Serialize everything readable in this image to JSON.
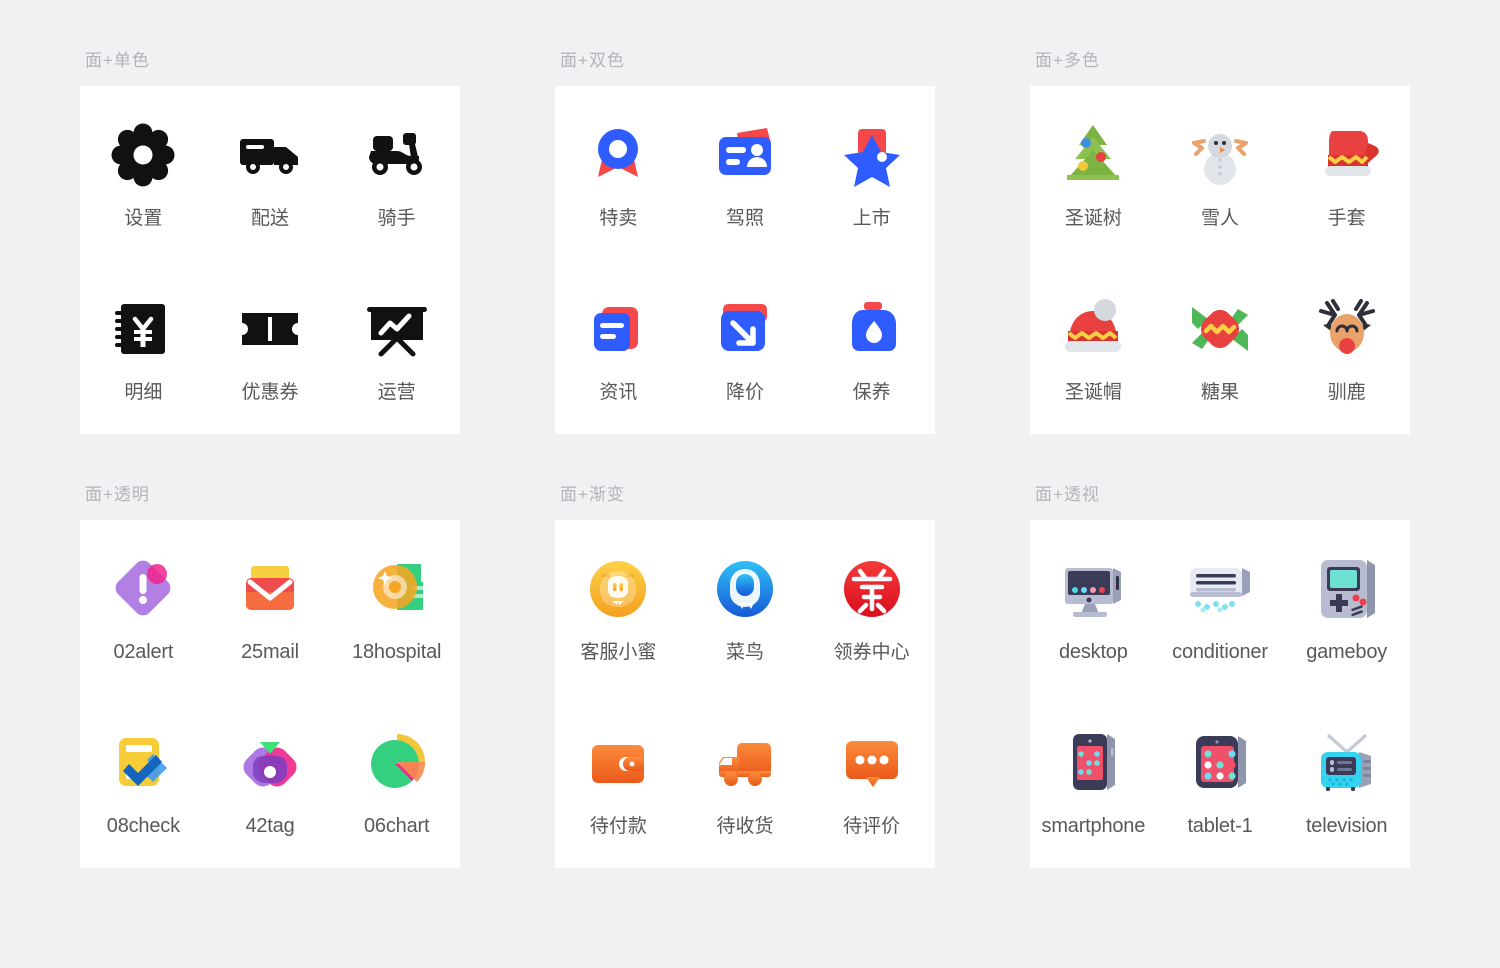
{
  "background_color": "#f0f1f3",
  "card_color": "#ffffff",
  "title_color": "#b3b5ba",
  "label_color": "#595959",
  "palette": {
    "mono_black": "#111111",
    "brand_blue": "#2f5cff",
    "brand_red": "#f5484a",
    "tree_green": "#7cb342",
    "santa_red": "#e8413f",
    "candy_yellow": "#f7d043",
    "snow_white": "#e2e6ea",
    "deer_tan": "#e8a26a",
    "purple": "#a568e0",
    "pink": "#f0258c",
    "mail_yellow": "#f7cf3f",
    "mail_red": "#ef4d4d",
    "coin_orange": "#f5a623",
    "money_green": "#35d07f",
    "check_yellow": "#f6cc38",
    "check_blue": "#1465c0",
    "gradient_orange_from": "#fb8c3c",
    "gradient_orange_to": "#ea5a1a",
    "gradient_yellow_from": "#fdd148",
    "gradient_yellow_to": "#f3a01f",
    "gradient_blue_from": "#2fc0f7",
    "gradient_blue_to": "#1559d6",
    "gradient_red_from": "#f53b3b",
    "gradient_red_to": "#d90d1e",
    "device_gray": "#b7bcd0",
    "device_navy": "#3b3b58",
    "tv_cyan": "#35d3ef"
  },
  "groups": [
    {
      "title": "面+单色",
      "style": "mono",
      "items": [
        {
          "label": "设置",
          "icon": "gear-icon"
        },
        {
          "label": "配送",
          "icon": "truck-icon"
        },
        {
          "label": "骑手",
          "icon": "scooter-rider-icon"
        },
        {
          "label": "明细",
          "icon": "yuan-ledger-icon"
        },
        {
          "label": "优惠券",
          "icon": "coupon-ticket-icon"
        },
        {
          "label": "运营",
          "icon": "presentation-chart-icon"
        }
      ]
    },
    {
      "title": "面+双色",
      "style": "duotone",
      "items": [
        {
          "label": "特卖",
          "icon": "medal-badge-icon"
        },
        {
          "label": "驾照",
          "icon": "drivers-license-icon"
        },
        {
          "label": "上市",
          "icon": "star-launch-icon"
        },
        {
          "label": "资讯",
          "icon": "news-document-icon"
        },
        {
          "label": "降价",
          "icon": "price-drop-arrow-icon"
        },
        {
          "label": "保养",
          "icon": "oil-bottle-icon"
        }
      ]
    },
    {
      "title": "面+多色",
      "style": "multicolor",
      "items": [
        {
          "label": "圣诞树",
          "icon": "christmas-tree-icon"
        },
        {
          "label": "雪人",
          "icon": "snowman-icon"
        },
        {
          "label": "手套",
          "icon": "mitten-glove-icon"
        },
        {
          "label": "圣诞帽",
          "icon": "santa-hat-icon"
        },
        {
          "label": "糖果",
          "icon": "candy-icon"
        },
        {
          "label": "驯鹿",
          "icon": "reindeer-icon"
        }
      ]
    },
    {
      "title": "面+透明",
      "style": "transparent",
      "items": [
        {
          "label": "02alert",
          "icon": "alert-diamond-icon",
          "latin": true
        },
        {
          "label": "25mail",
          "icon": "mail-envelope-icon",
          "latin": true
        },
        {
          "label": "18hospital",
          "icon": "hospital-coin-icon",
          "latin": true
        },
        {
          "label": "08check",
          "icon": "checklist-icon",
          "latin": true
        },
        {
          "label": "42tag",
          "icon": "tag-icon",
          "latin": true
        },
        {
          "label": "06chart",
          "icon": "pie-chart-icon",
          "latin": true
        }
      ]
    },
    {
      "title": "面+渐变",
      "style": "gradient",
      "items": [
        {
          "label": "客服小蜜",
          "icon": "service-pig-icon"
        },
        {
          "label": "菜鸟",
          "icon": "cainiao-bird-icon"
        },
        {
          "label": "领券中心",
          "icon": "coupon-quan-icon"
        },
        {
          "label": "待付款",
          "icon": "wallet-icon"
        },
        {
          "label": "待收货",
          "icon": "delivery-truck-icon"
        },
        {
          "label": "待评价",
          "icon": "comment-bubble-icon"
        }
      ]
    },
    {
      "title": "面+透视",
      "style": "perspective",
      "items": [
        {
          "label": "desktop",
          "icon": "desktop-computer-icon",
          "latin": true
        },
        {
          "label": "conditioner",
          "icon": "air-conditioner-icon",
          "latin": true
        },
        {
          "label": "gameboy",
          "icon": "gameboy-console-icon",
          "latin": true
        },
        {
          "label": "smartphone",
          "icon": "smartphone-icon",
          "latin": true
        },
        {
          "label": "tablet-1",
          "icon": "tablet-icon",
          "latin": true
        },
        {
          "label": "television",
          "icon": "television-icon",
          "latin": true
        }
      ]
    }
  ]
}
